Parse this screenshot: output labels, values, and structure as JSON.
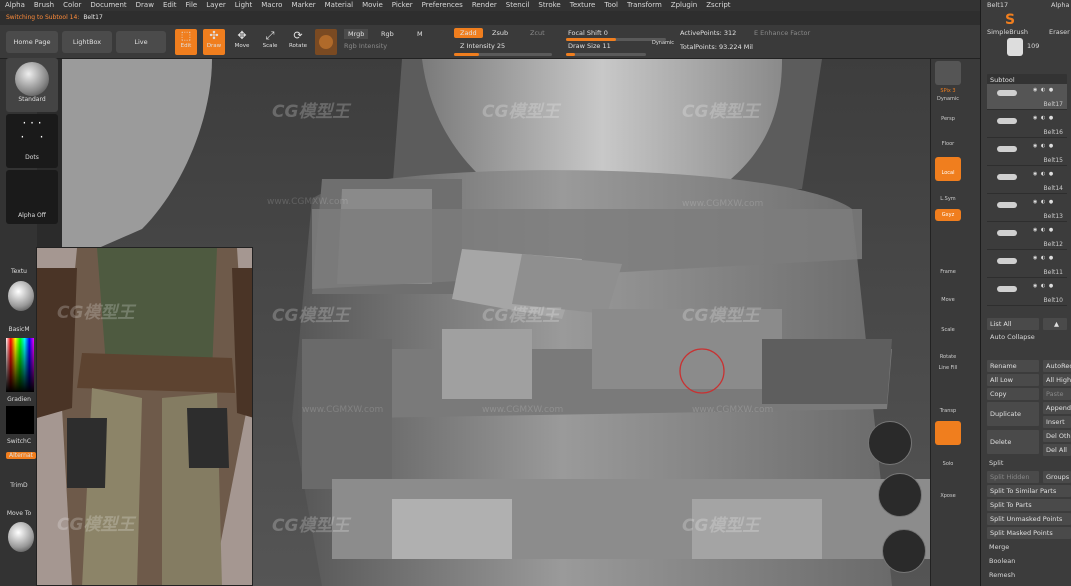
{
  "menu": [
    "Alpha",
    "Brush",
    "Color",
    "Document",
    "Draw",
    "Edit",
    "File",
    "Layer",
    "Light",
    "Macro",
    "Marker",
    "Material",
    "Movie",
    "Picker",
    "Preferences",
    "Render",
    "Stencil",
    "Stroke",
    "Texture",
    "Tool",
    "Transform",
    "Zplugin",
    "Zscript"
  ],
  "status": {
    "message": "Switching to Subtool 14:",
    "subtool": "Belt17"
  },
  "topbar": {
    "home_page": "Home Page",
    "lightbox": "LightBox",
    "live_boolean": "Live Boolean",
    "edit": "Edit",
    "draw": "Draw",
    "move": "Move",
    "scale": "Scale",
    "rotate": "Rotate",
    "mrgb": "Mrgb",
    "rgb": "Rgb",
    "m": "M",
    "rgb_intensity": "Rgb Intensity",
    "zadd": "Zadd",
    "zsub": "Zsub",
    "zcut": "Zcut",
    "z_intensity_label": "Z Intensity",
    "z_intensity_value": "25",
    "focal_shift_label": "Focal Shift",
    "focal_shift_value": "0",
    "draw_size_label": "Draw Size",
    "draw_size_value": "11",
    "dynamic": "Dynamic",
    "active_points": "ActivePoints: 312",
    "total_points": "TotalPoints: 93.224 Mil",
    "enhance_factor": "E Enhance Factor"
  },
  "left_shelf": {
    "standard": "Standard",
    "dots": "Dots",
    "alpha_off": "Alpha Off",
    "texture": "Textu",
    "basic_material": "BasicM",
    "gradient": "Gradien",
    "switch_color": "SwitchC",
    "alternate": "Alternat",
    "trim": "TrimD",
    "move_tool": "Move To"
  },
  "right_shelf": [
    "SPix 3",
    "Dynamic",
    "Persp",
    "Floor",
    "Local",
    "L.Sym",
    "Gxyz",
    "Frame",
    "Move",
    "Scale",
    "Rotate",
    "Line Fill",
    "Transp",
    "Solo",
    "Xpose"
  ],
  "tray": {
    "alpha": "Alpha",
    "belt17_top": "Belt17",
    "simplebrush": "SimpleBrush",
    "eraser": "Eraser",
    "count": "109",
    "subtool_header": "Subtool",
    "subtools": [
      "Belt17",
      "Belt16",
      "Belt15",
      "Belt14",
      "Belt13",
      "Belt12",
      "Belt11",
      "Belt10"
    ],
    "list_all": "List All",
    "auto_collapse": "Auto Collapse",
    "rename": "Rename",
    "autoreorder": "AutoReo",
    "all_low": "All Low",
    "all_high": "All High",
    "copy": "Copy",
    "paste": "Paste",
    "duplicate": "Duplicate",
    "append": "Append",
    "insert": "Insert",
    "delete": "Delete",
    "del_other": "Del Othe",
    "del_all": "Del All",
    "split": "Split",
    "split_hidden": "Split Hidden",
    "groups": "Groups",
    "split_similar": "Split To Similar Parts",
    "split_parts": "Split To Parts",
    "split_unmasked": "Split Unmasked Points",
    "split_masked": "Split Masked Points",
    "merge": "Merge",
    "boolean": "Boolean",
    "remesh": "Remesh"
  },
  "watermark": {
    "brand": "CG模型王",
    "url": "www.CGMXW.com"
  },
  "colors": {
    "accent": "#f07e1e",
    "panel": "#3a3a3a",
    "background": "#2b2b2b"
  }
}
